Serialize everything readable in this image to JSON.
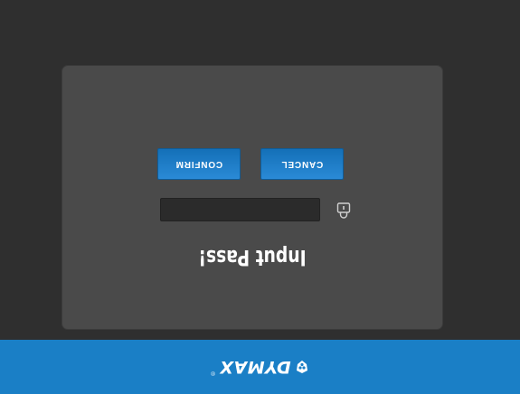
{
  "brand": {
    "name": "DYMAX",
    "registered": "®",
    "icon": "dymax-shield-icon",
    "bar_color": "#1a7fc6"
  },
  "dialog": {
    "title": "Input   Pass!",
    "lock_icon": "lock-icon",
    "password_value": "",
    "cancel_label": "CANCEL",
    "confirm_label": "CONFIRM",
    "button_color": "#1a7fc6"
  }
}
